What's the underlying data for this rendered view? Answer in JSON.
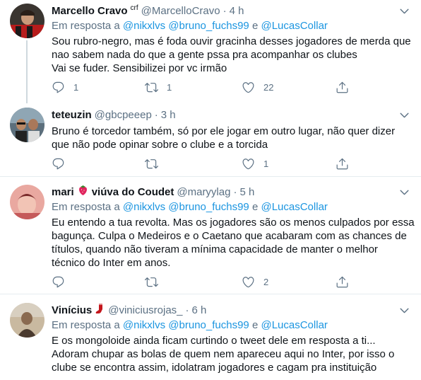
{
  "tweets": [
    {
      "name": "Marcello Cravo",
      "badge": "crf",
      "handle": "@MarcelloCravo",
      "sep": "·",
      "time": "4 h",
      "reply_label": "Em resposta a",
      "mentions": [
        "@nikxlvs",
        "@bruno_fuchs99"
      ],
      "reply_and": "e",
      "last_mention": "@LucasCollar",
      "lines": [
        "Sou rubro-negro, mas é foda ouvir gracinha desses jogadores de merda que",
        "nao sabem nada do que a gente pssa pra acompanhar os clubes",
        "Vai se fuder. Sensibilizei por vc irmão"
      ],
      "replies": "1",
      "retweets": "1",
      "likes": "22"
    },
    {
      "name": "teteuzin",
      "handle": "@gbcpeeep",
      "sep": "·",
      "time": "3 h",
      "lines": [
        "Bruno é torcedor também, só por ele jogar em outro lugar, não quer dizer",
        "que não pode opinar sobre o clube e a torcida"
      ],
      "replies": "",
      "retweets": "",
      "likes": "1"
    },
    {
      "name": "mari",
      "name_suffix": "viúva do Coudet",
      "handle": "@maryylag",
      "sep": "·",
      "time": "5 h",
      "reply_label": "Em resposta a",
      "mentions": [
        "@nikxlvs",
        "@bruno_fuchs99"
      ],
      "reply_and": "e",
      "last_mention": "@LucasCollar",
      "lines": [
        "Eu entendo a tua revolta. Mas os jogadores são os menos culpados por essa",
        "bagunça. Culpa o Medeiros e o Caetano que acabaram com as chances de",
        "títulos, quando não tiveram a mínima capacidade de manter o melhor",
        "técnico do Inter em anos."
      ],
      "replies": "",
      "retweets": "",
      "likes": "2"
    },
    {
      "name": "Vinícius",
      "handle": "@viniciusrojas_",
      "sep": "·",
      "time": "6 h",
      "reply_label": "Em resposta a",
      "mentions": [
        "@nikxlvs",
        "@bruno_fuchs99"
      ],
      "reply_and": "e",
      "last_mention": "@LucasCollar",
      "lines": [
        "E os mongoloide ainda ficam curtindo o tweet dele em resposta a ti...",
        "Adoram chupar as bolas de quem nem apareceu aqui no Inter, por isso o",
        "clube se encontra assim, idolatram jogadores e cagam pra instituição"
      ]
    }
  ],
  "colors": {
    "text": "#0f1419",
    "secondary": "#5b7083",
    "link": "#1b95e0",
    "divider": "#e6ecf0",
    "strawberry": "#e0245e",
    "sock": "#c4161c"
  },
  "icons": [
    "reply-icon",
    "retweet-icon",
    "like-icon",
    "share-icon",
    "caret-down-icon",
    "strawberry-icon",
    "red-sock-icon"
  ]
}
